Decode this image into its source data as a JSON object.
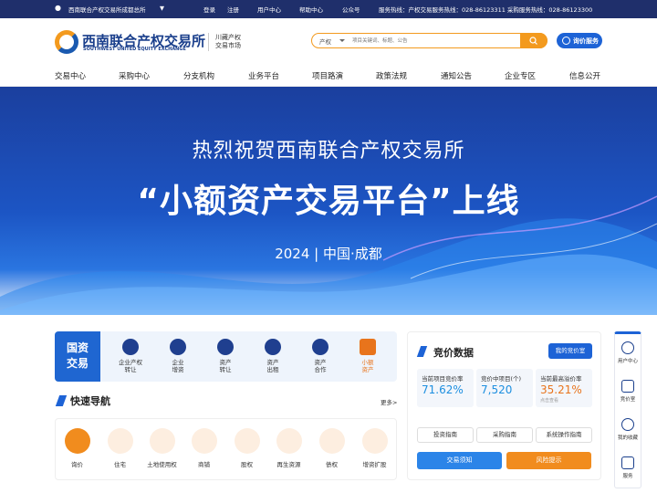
{
  "topbar": {
    "org": "西南联合产权交易所成都总所",
    "login": "登录",
    "register": "注册",
    "user_center": "用户中心",
    "help_center": "帮助中心",
    "wechat": "公众号",
    "hotline": "服务热线：产权交易服务热线：028-86123311 采购服务热线：028-86123300"
  },
  "header": {
    "logo_cn": "西南联合产权交易所",
    "logo_en": "SOUTHWEST UNITED EQUITY EXCHANGE",
    "logo_sub_1": "川藏产权",
    "logo_sub_2": "交易市场",
    "search_select": "产权",
    "search_placeholder": "项目关键词、标题、公告",
    "bid_button": "询价服务"
  },
  "nav": [
    "交易中心",
    "采购中心",
    "分支机构",
    "业务平台",
    "项目路演",
    "政策法规",
    "通知公告",
    "企业专区",
    "信息公开"
  ],
  "banner": {
    "line1": "热烈祝贺西南联合产权交易所",
    "line2": "“小额资产交易平台”上线",
    "line3": "2024 | 中国·成都"
  },
  "guozi": {
    "label_1": "国资",
    "label_2": "交易",
    "items": [
      [
        "企业产权",
        "转让"
      ],
      [
        "企业",
        "增资"
      ],
      [
        "资产",
        "转让"
      ],
      [
        "资产",
        "出租"
      ],
      [
        "资产",
        "合作"
      ],
      [
        "小额",
        "资产"
      ]
    ]
  },
  "quicknav": {
    "title": "快速导航",
    "more": "更多>",
    "items": [
      "询价",
      "住宅",
      "土地使用权",
      "商铺",
      "股权",
      "再生资源",
      "债权",
      "增资扩股"
    ]
  },
  "bidding": {
    "title": "竞价数据",
    "my_button": "我的竞价室",
    "stats": [
      {
        "k": "当前项目竞价率",
        "v": "71.62%",
        "s": ""
      },
      {
        "k": "竞价中项目(个)",
        "v": "7,520",
        "s": ""
      },
      {
        "k": "当前最高溢价率",
        "v": "35.21%",
        "s": "点击查看"
      }
    ],
    "guides": [
      "投资指南",
      "采购指南",
      "系统操作指南"
    ],
    "notice": "交易须知",
    "risk": "风险提示"
  },
  "side": [
    "用户中心",
    "竞价室",
    "我的收藏",
    "服务"
  ],
  "colors": {
    "primary": "#1d63d6",
    "accent": "#f39a1e",
    "topbar": "#1f2f6b"
  }
}
